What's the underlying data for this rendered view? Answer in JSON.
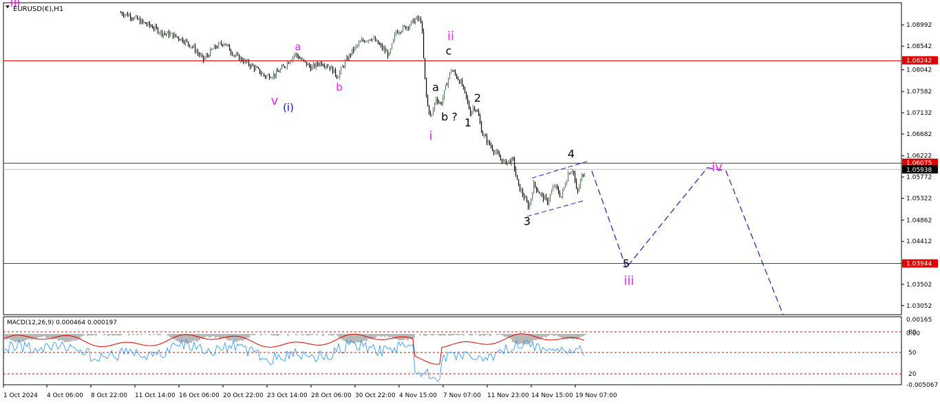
{
  "chart_data": {
    "type": "candlestick",
    "symbol": "EURUSD(€),H1",
    "price_axis": {
      "ylim": [
        1.0286,
        1.0946
      ],
      "ticks": [
        "1.08992",
        "1.08542",
        "1.08042",
        "1.07582",
        "1.07132",
        "1.06682",
        "1.06222",
        "1.05772",
        "1.05322",
        "1.04862",
        "1.04412",
        "1.03952",
        "1.03502",
        "1.03052"
      ],
      "current_price": "1.05938"
    },
    "horizontal_levels": [
      {
        "label": "1.08242",
        "value": 1.08242
      },
      {
        "label": "1.06075",
        "value": 1.06075
      },
      {
        "label": "1.03944",
        "value": 1.03944
      }
    ],
    "x_ticks": [
      "1 Oct 2024",
      "4 Oct 06:00",
      "8 Oct 22:00",
      "11 Oct 14:00",
      "16 Oct 06:00",
      "20 Oct 22:00",
      "23 Oct 14:00",
      "28 Oct 06:00",
      "30 Oct 22:00",
      "4 Nov 15:00",
      "7 Nov 07:00",
      "11 Nov 23:00",
      "14 Nov 15:00",
      "19 Nov 07:00"
    ],
    "wave_labels": [
      {
        "text": "iii",
        "style": "magenta",
        "price": 1.0938,
        "bar": 22
      },
      {
        "text": "a",
        "style": "magenta",
        "price": 1.0846,
        "bar": 433
      },
      {
        "text": "b",
        "style": "magenta",
        "price": 1.076,
        "bar": 493
      },
      {
        "text": "v",
        "style": "magenta",
        "price": 1.073,
        "bar": 399
      },
      {
        "text": "(i)",
        "style": "blue",
        "price": 1.0717,
        "bar": 419
      },
      {
        "text": "ii",
        "style": "magenta",
        "price": 1.0867,
        "bar": 655
      },
      {
        "text": "c",
        "style": "black",
        "price": 1.0836,
        "bar": 652
      },
      {
        "text": "a",
        "style": "black",
        "price": 1.0759,
        "bar": 633
      },
      {
        "text": "b ?",
        "style": "black",
        "price": 1.0697,
        "bar": 653
      },
      {
        "text": "2",
        "style": "black",
        "price": 1.0737,
        "bar": 694
      },
      {
        "text": "1",
        "style": "black",
        "price": 1.0684,
        "bar": 680
      },
      {
        "text": "i",
        "style": "magenta",
        "price": 1.0656,
        "bar": 626
      },
      {
        "text": "4",
        "style": "black",
        "price": 1.0618,
        "bar": 830
      },
      {
        "text": "3",
        "style": "black",
        "price": 1.0476,
        "bar": 766
      },
      {
        "text": "5",
        "style": "black",
        "price": 1.0386,
        "bar": 910
      },
      {
        "text": "iii",
        "style": "magenta",
        "price": 1.0349,
        "bar": 914
      },
      {
        "text": "iv",
        "style": "magenta",
        "price": 1.059,
        "bar": 1042
      }
    ],
    "close_path": [
      [
        175,
        1.0925
      ],
      [
        190,
        1.0918
      ],
      [
        205,
        1.0905
      ],
      [
        220,
        1.0896
      ],
      [
        235,
        1.0882
      ],
      [
        250,
        1.0878
      ],
      [
        265,
        1.0868
      ],
      [
        280,
        1.0852
      ],
      [
        295,
        1.0825
      ],
      [
        310,
        1.085
      ],
      [
        325,
        1.0862
      ],
      [
        340,
        1.0835
      ],
      [
        355,
        1.0822
      ],
      [
        370,
        1.0808
      ],
      [
        385,
        1.079
      ],
      [
        400,
        1.0795
      ],
      [
        415,
        1.0815
      ],
      [
        428,
        1.0838
      ],
      [
        440,
        1.0822
      ],
      [
        452,
        1.0808
      ],
      [
        465,
        1.082
      ],
      [
        478,
        1.0812
      ],
      [
        490,
        1.079
      ],
      [
        500,
        1.0818
      ],
      [
        512,
        1.0845
      ],
      [
        525,
        1.0865
      ],
      [
        540,
        1.0872
      ],
      [
        555,
        1.085
      ],
      [
        565,
        1.0835
      ],
      [
        575,
        1.0885
      ],
      [
        590,
        1.0895
      ],
      [
        605,
        1.0912
      ],
      [
        612,
        1.0908
      ],
      [
        616,
        1.08
      ],
      [
        620,
        1.0732
      ],
      [
        626,
        1.0702
      ],
      [
        633,
        1.0745
      ],
      [
        640,
        1.073
      ],
      [
        648,
        1.0772
      ],
      [
        655,
        1.0805
      ],
      [
        662,
        1.0792
      ],
      [
        670,
        1.0775
      ],
      [
        678,
        1.074
      ],
      [
        683,
        1.0712
      ],
      [
        688,
        1.0728
      ],
      [
        694,
        1.0712
      ],
      [
        700,
        1.067
      ],
      [
        710,
        1.0648
      ],
      [
        720,
        1.0628
      ],
      [
        732,
        1.0608
      ],
      [
        745,
        1.0612
      ],
      [
        752,
        1.056
      ],
      [
        760,
        1.0538
      ],
      [
        768,
        1.0512
      ],
      [
        775,
        1.0562
      ],
      [
        785,
        1.054
      ],
      [
        795,
        1.0525
      ],
      [
        805,
        1.056
      ],
      [
        815,
        1.0535
      ],
      [
        825,
        1.0585
      ],
      [
        832,
        1.0595
      ],
      [
        838,
        1.054
      ],
      [
        845,
        1.058
      ],
      [
        850,
        1.0588
      ]
    ],
    "channel_lines": [
      {
        "from": [
          773,
          1.0575
        ],
        "to": [
          855,
          1.0611
        ]
      },
      {
        "from": [
          766,
          1.0494
        ],
        "to": [
          848,
          1.0527
        ]
      }
    ],
    "projection": [
      [
        860,
        1.059
      ],
      [
        910,
        1.0385
      ],
      [
        1028,
        1.0597
      ],
      [
        1055,
        1.059
      ],
      [
        1138,
        1.0286
      ]
    ],
    "macd": {
      "label": "MACD(12,26,9) 0.000464 0.000197",
      "ticks": [
        "0.00165",
        "0.00",
        "-0.005067"
      ],
      "stoch_levels": [
        "80",
        "50",
        "20"
      ]
    }
  }
}
